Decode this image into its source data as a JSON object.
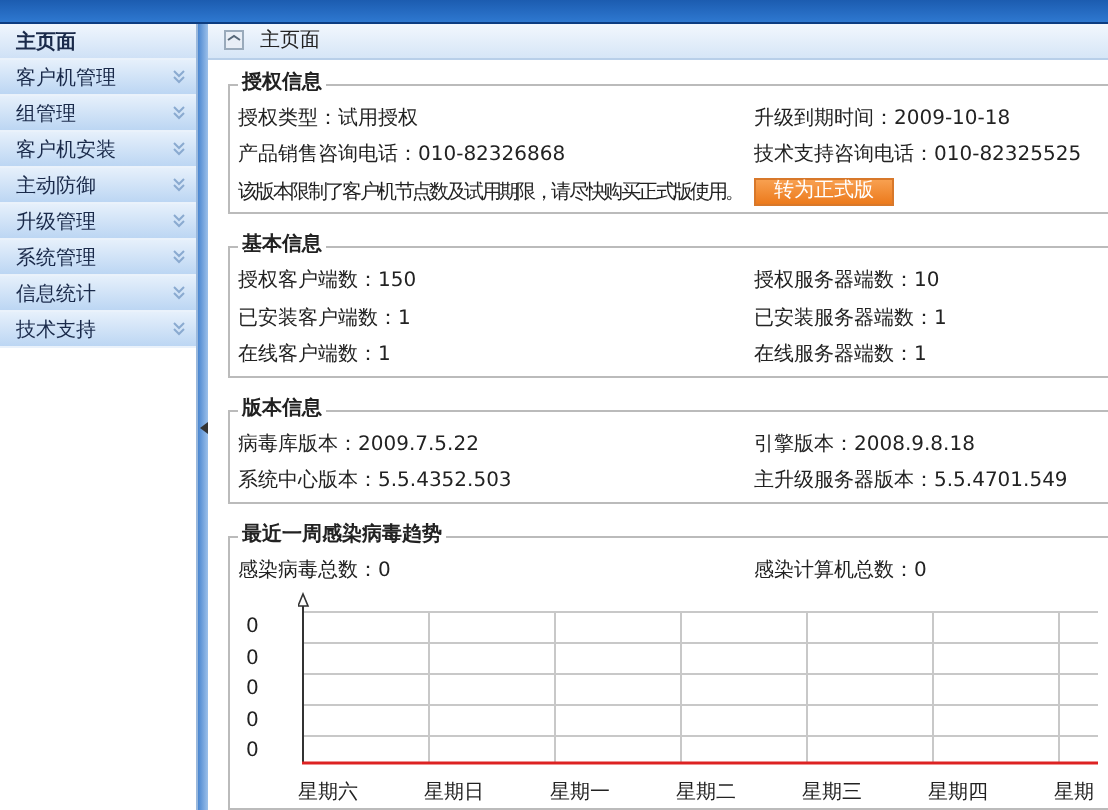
{
  "sidebar": {
    "items": [
      {
        "label": "主页面",
        "kind": "page",
        "selected": true
      },
      {
        "label": "客户机管理",
        "kind": "menu",
        "selected": false
      },
      {
        "label": "组管理",
        "kind": "menu",
        "selected": false
      },
      {
        "label": "客户机安装",
        "kind": "menu",
        "selected": false
      },
      {
        "label": "主动防御",
        "kind": "menu",
        "selected": false
      },
      {
        "label": "升级管理",
        "kind": "menu",
        "selected": false
      },
      {
        "label": "系统管理",
        "kind": "menu",
        "selected": false
      },
      {
        "label": "信息统计",
        "kind": "menu",
        "selected": false
      },
      {
        "label": "技术支持",
        "kind": "menu",
        "selected": false
      }
    ]
  },
  "page": {
    "title": "主页面"
  },
  "sections": [
    {
      "title": "授权信息",
      "rows": [
        [
          "授权类型：试用授权",
          "升级到期时间：2009-10-18"
        ],
        [
          "产品销售咨询电话：010-82326868",
          "技术支持咨询电话：010-82325525"
        ]
      ],
      "notice": "该版本限制了客户机节点数及试用期限，请尽快购买正式版使用。",
      "button": "转为正式版"
    },
    {
      "title": "基本信息",
      "rows": [
        [
          "授权客户端数：150",
          "授权服务器端数：10"
        ],
        [
          "已安装客户端数：1",
          "已安装服务器端数：1"
        ],
        [
          "在线客户端数：1",
          "在线服务器端数：1"
        ]
      ]
    },
    {
      "title": "版本信息",
      "rows": [
        [
          "病毒库版本：2009.7.5.22",
          "引擎版本：2008.9.8.18"
        ],
        [
          "系统中心版本：5.5.4352.503",
          "主升级服务器版本：5.5.4701.549"
        ]
      ]
    }
  ],
  "trend": {
    "title": "最近一周感染病毒趋势",
    "stats": [
      "感染病毒总数：0",
      "感染计算机总数：0"
    ],
    "y_labels": [
      "0",
      "0",
      "0",
      "0",
      "0"
    ],
    "x_labels": [
      "星期六",
      "星期日",
      "星期一",
      "星期二",
      "星期三",
      "星期四",
      "星期"
    ]
  }
}
